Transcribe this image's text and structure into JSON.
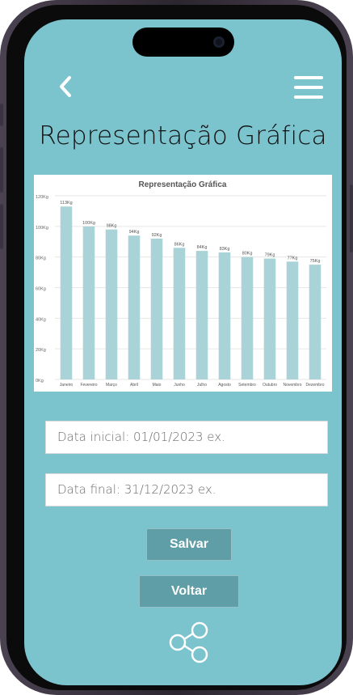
{
  "header": {
    "title": "Representação Gráfica",
    "back_icon": "chevron-left-icon",
    "menu_icon": "hamburger-menu-icon"
  },
  "chart_data": {
    "type": "bar",
    "title": "Representação Gráfica",
    "categories": [
      "Janeiro",
      "Fevereiro",
      "Março",
      "Abril",
      "Maio",
      "Junho",
      "Julho",
      "Agosto",
      "Setembro",
      "Outubro",
      "Novembro",
      "Dezembro"
    ],
    "values": [
      113,
      100,
      98,
      94,
      92,
      86,
      84,
      83,
      80,
      79,
      77,
      75
    ],
    "data_labels": [
      "113Kg",
      "100Kg",
      "98Kg",
      "94Kg",
      "92Kg",
      "86Kg",
      "84Kg",
      "83Kg",
      "80Kg",
      "79Kg",
      "77Kg",
      "75Kg"
    ],
    "ytick_labels": [
      "0Kg",
      "20Kg",
      "40Kg",
      "60Kg",
      "80Kg",
      "100Kg",
      "120Kg"
    ],
    "ylim": [
      0,
      120
    ],
    "grid": true,
    "bar_color": "#a9d3d6"
  },
  "form": {
    "start_placeholder": "Data inicial: 01/01/2023 ex.",
    "end_placeholder": "Data final: 31/12/2023 ex."
  },
  "buttons": {
    "save_label": "Salvar",
    "back_label": "Voltar"
  },
  "share": {
    "icon": "share-icon"
  },
  "colors": {
    "screen_bg": "#7bc3cd",
    "button_bg": "#5f9ea6"
  }
}
